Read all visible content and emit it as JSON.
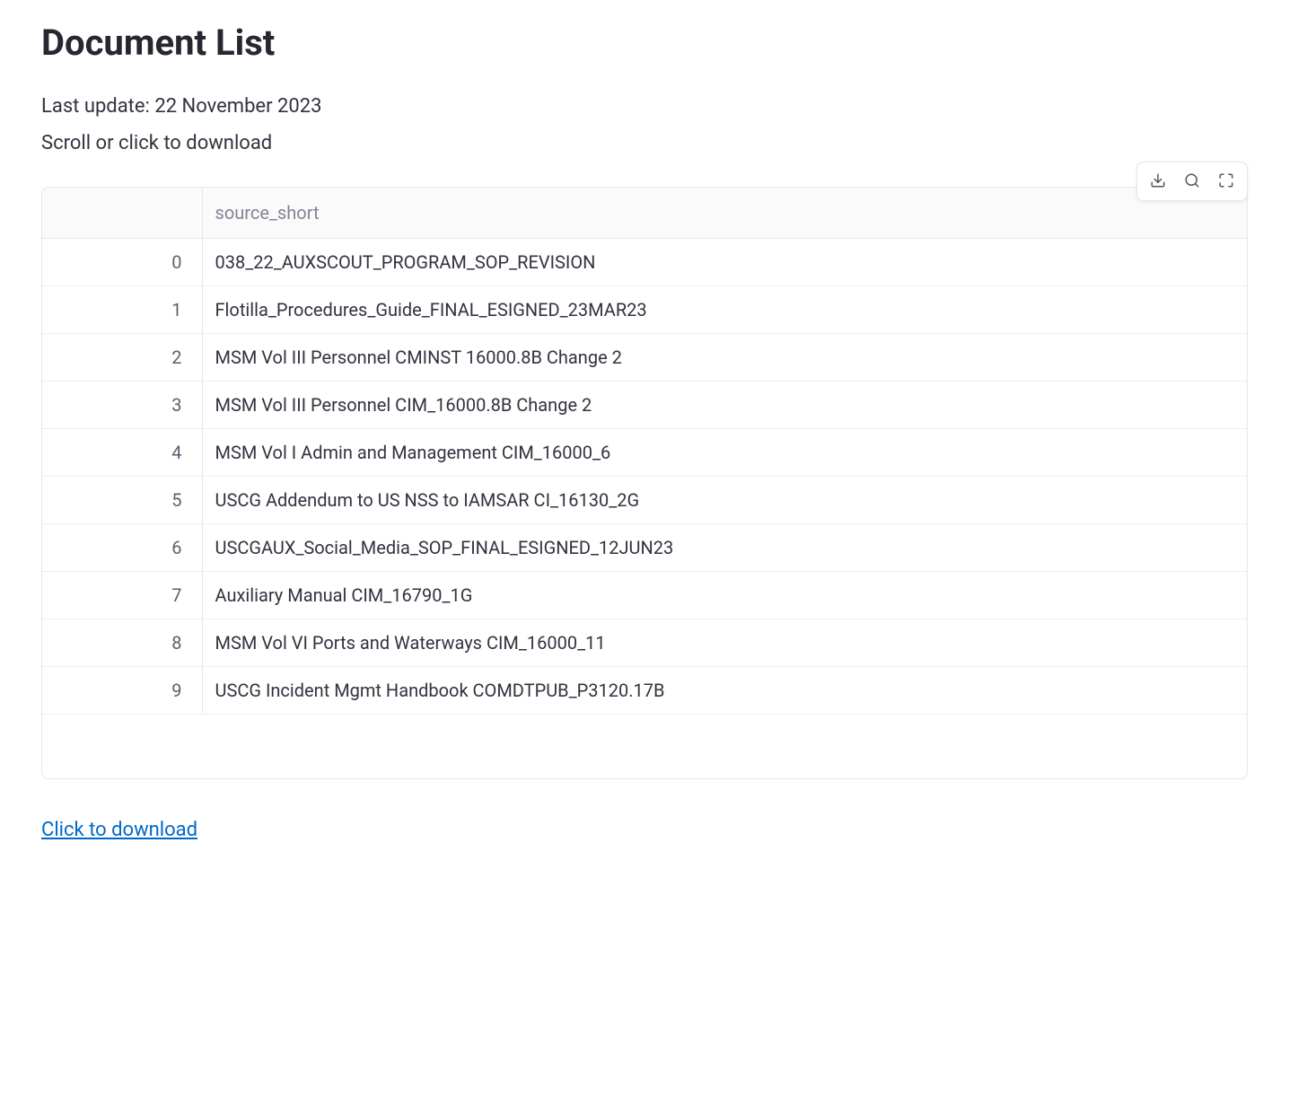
{
  "header": {
    "title": "Document List",
    "last_update": "Last update: 22 November 2023",
    "instruction": "Scroll or click to download"
  },
  "toolbar": {
    "download_tooltip": "Download",
    "search_tooltip": "Search",
    "fullscreen_tooltip": "Fullscreen"
  },
  "table": {
    "columns": [
      "",
      "source_short"
    ],
    "rows": [
      {
        "idx": "0",
        "source_short": "038_22_AUXSCOUT_PROGRAM_SOP_REVISION"
      },
      {
        "idx": "1",
        "source_short": "Flotilla_Procedures_Guide_FINAL_ESIGNED_23MAR23"
      },
      {
        "idx": "2",
        "source_short": "MSM Vol III Personnel CMINST 16000.8B Change 2"
      },
      {
        "idx": "3",
        "source_short": "MSM Vol III Personnel CIM_16000.8B Change 2"
      },
      {
        "idx": "4",
        "source_short": "MSM Vol I Admin and Management CIM_16000_6"
      },
      {
        "idx": "5",
        "source_short": "USCG Addendum to US NSS to IAMSAR CI_16130_2G"
      },
      {
        "idx": "6",
        "source_short": "USCGAUX_Social_Media_SOP_FINAL_ESIGNED_12JUN23"
      },
      {
        "idx": "7",
        "source_short": "Auxiliary Manual CIM_16790_1G"
      },
      {
        "idx": "8",
        "source_short": "MSM Vol VI Ports and Waterways CIM_16000_11"
      },
      {
        "idx": "9",
        "source_short": "USCG Incident Mgmt Handbook COMDTPUB_P3120.17B"
      }
    ]
  },
  "footer": {
    "download_link_label": "Click to download"
  }
}
